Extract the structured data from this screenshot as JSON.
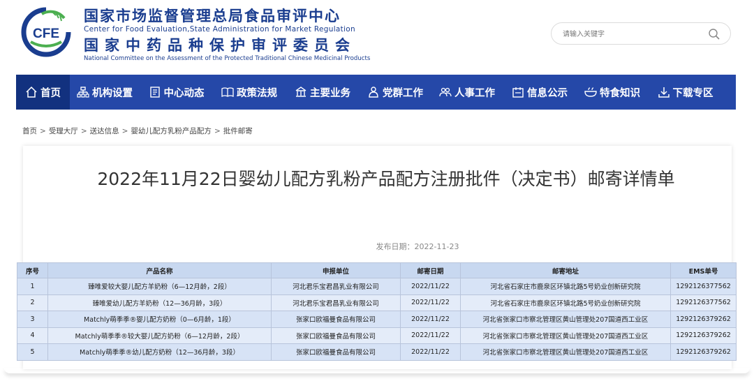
{
  "header": {
    "logo_text": "CFE",
    "org_cn_1": "国家市场监督管理总局食品审评中心",
    "org_en_1": "Center for Food Evaluation,State Administration for Market Regulation",
    "org_cn_2": "国家中药品种保护审评委员会",
    "org_en_2": "National Committee on the Assessment of the Protected Traditional Chinese Medicinal Products",
    "search_placeholder": "请输入关键字"
  },
  "nav": {
    "items": [
      {
        "label": "首页",
        "icon": "home-icon"
      },
      {
        "label": "机构设置",
        "icon": "org-chart-icon"
      },
      {
        "label": "中心动态",
        "icon": "document-icon"
      },
      {
        "label": "政策法规",
        "icon": "book-icon"
      },
      {
        "label": "主要业务",
        "icon": "building-icon"
      },
      {
        "label": "党群工作",
        "icon": "person-icon"
      },
      {
        "label": "人事工作",
        "icon": "people-icon"
      },
      {
        "label": "信息公示",
        "icon": "notice-icon"
      },
      {
        "label": "特食知识",
        "icon": "bowl-icon"
      },
      {
        "label": "下载专区",
        "icon": "download-icon"
      }
    ]
  },
  "breadcrumb": [
    "首页",
    "受理大厅",
    "送达信息",
    "婴幼儿配方乳粉产品配方",
    "批件邮寄"
  ],
  "article": {
    "title": "2022年11月22日婴幼儿配方乳粉产品配方注册批件（决定书）邮寄详情单",
    "pubdate": "发布日期：2022-11-23"
  },
  "table": {
    "headers": [
      "序号",
      "产品名称",
      "申报单位",
      "邮寄日期",
      "邮寄地址",
      "EMS单号"
    ],
    "rows": [
      [
        "1",
        "臻唯爱较大婴儿配方羊奶粉（6—12月龄，2段）",
        "河北君乐宝君昌乳业有限公司",
        "2022/11/22",
        "河北省石家庄市鹿泉区环镇北路5号奶业创新研究院",
        "1292126377562"
      ],
      [
        "2",
        "臻唯爱幼儿配方羊奶粉（12—36月龄，3段）",
        "河北君乐宝君昌乳业有限公司",
        "2022/11/22",
        "河北省石家庄市鹿泉区环镇北路5号奶业创新研究院",
        "1292126377562"
      ],
      [
        "3",
        "Matchly萌季季®婴儿配方奶粉（0—6月龄，1段）",
        "张家口欧福曼食品有限公司",
        "2022/11/22",
        "河北省张家口市察北管理区黄山管理处207国道西工业区",
        "1292126379262"
      ],
      [
        "4",
        "Matchly萌季季®较大婴儿配方奶粉（6—12月龄，2段）",
        "张家口欧福曼食品有限公司",
        "2022/11/22",
        "河北省张家口市察北管理区黄山管理处207国道西工业区",
        "1292126379262"
      ],
      [
        "5",
        "Matchly萌季季®幼儿配方奶粉（12—36月龄，3段）",
        "张家口欧福曼食品有限公司",
        "2022/11/22",
        "河北省张家口市察北管理区黄山管理处207国道西工业区",
        "1292126379262"
      ]
    ]
  },
  "colors": {
    "nav_bg": "#2548a8",
    "nav_active": "#12317f",
    "brand_blue": "#1a3d8f",
    "logo_green": "#4caf50",
    "table_header": "#c8d8f0",
    "table_row": "#d7e3f6"
  }
}
